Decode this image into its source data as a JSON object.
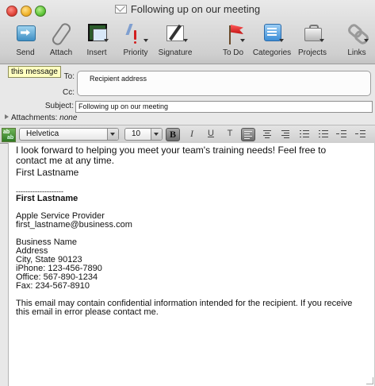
{
  "window": {
    "title": "Following up on our meeting"
  },
  "toolbar": {
    "items": [
      {
        "label": "Send",
        "icon": "send-icon"
      },
      {
        "label": "Attach",
        "icon": "paperclip-icon"
      },
      {
        "label": "Insert",
        "icon": "insert-media-icon"
      },
      {
        "label": "Priority",
        "icon": "priority-icon"
      },
      {
        "label": "Signature",
        "icon": "signature-icon"
      },
      {
        "label": "To Do",
        "icon": "flag-icon"
      },
      {
        "label": "Categories",
        "icon": "categories-icon"
      },
      {
        "label": "Projects",
        "icon": "projects-icon"
      },
      {
        "label": "Links",
        "icon": "links-icon"
      }
    ]
  },
  "header": {
    "tooltip": "this message",
    "to_label": "To:",
    "to_value": "Recipient address",
    "cc_label": "Cc:",
    "subject_label": "Subject:",
    "subject_value": "Following up on our meeting",
    "attachments_label": "Attachments:",
    "attachments_value": "none"
  },
  "format_bar": {
    "font": "Helvetica",
    "size": "10",
    "bold": "B",
    "italic": "I",
    "underline": "U",
    "text_color": "T"
  },
  "body": {
    "intro": "I look forward to helping you meet your team's training needs! Feel free to contact me at any time.",
    "sign_name": "First Lastname",
    "separator": "--------------------",
    "sig_name": "First Lastname",
    "role": "Apple Service Provider",
    "email": "first_lastname@business.com",
    "business": "Business Name",
    "address": "Address",
    "city": "City, State 90123",
    "iphone": "iPhone: 123-456-7890",
    "office": "Office: 567-890-1234",
    "fax": "Fax: 234-567-8910",
    "disclaimer": "This email may contain confidential information intended for the recipient. If you receive this email in error please contact me."
  }
}
